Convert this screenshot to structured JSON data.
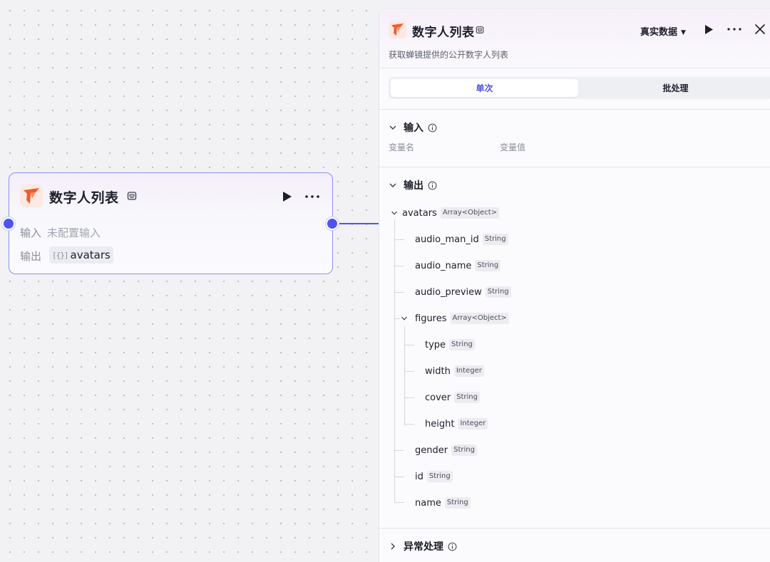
{
  "node": {
    "title": "数字人列表",
    "input_label": "输入",
    "input_value": "未配置输入",
    "output_label": "输出",
    "output_bracket": "[{}]",
    "output_value": "avatars"
  },
  "panel": {
    "title": "数字人列表",
    "data_select": "真实数据",
    "description": "获取蝉镜提供的公开数字人列表",
    "tabs": [
      "单次",
      "批处理"
    ],
    "input_section": {
      "title": "输入",
      "col_name": "变量名",
      "col_value": "变量值"
    },
    "output_section": {
      "title": "输出",
      "root": {
        "name": "avatars",
        "type": "Array<Object>"
      },
      "fields": [
        {
          "name": "audio_man_id",
          "type": "String"
        },
        {
          "name": "audio_name",
          "type": "String"
        },
        {
          "name": "audio_preview",
          "type": "String"
        },
        {
          "name": "figures",
          "type": "Array<Object>"
        },
        {
          "name": "type",
          "type": "String"
        },
        {
          "name": "width",
          "type": "Integer"
        },
        {
          "name": "cover",
          "type": "String"
        },
        {
          "name": "height",
          "type": "Integer"
        },
        {
          "name": "gender",
          "type": "String"
        },
        {
          "name": "id",
          "type": "String"
        },
        {
          "name": "name",
          "type": "String"
        }
      ]
    },
    "error_section": {
      "title": "异常处理"
    }
  },
  "colors": {
    "accent": "#4f54f0",
    "node_border": "#8e8ff4",
    "logo_orange": "#f25a2e"
  },
  "icons": [
    "logo-icon",
    "api-badge-icon",
    "play-icon",
    "more-icon",
    "close-icon",
    "chevron-down-icon",
    "chevron-right-icon",
    "info-icon",
    "caret-down-icon"
  ]
}
